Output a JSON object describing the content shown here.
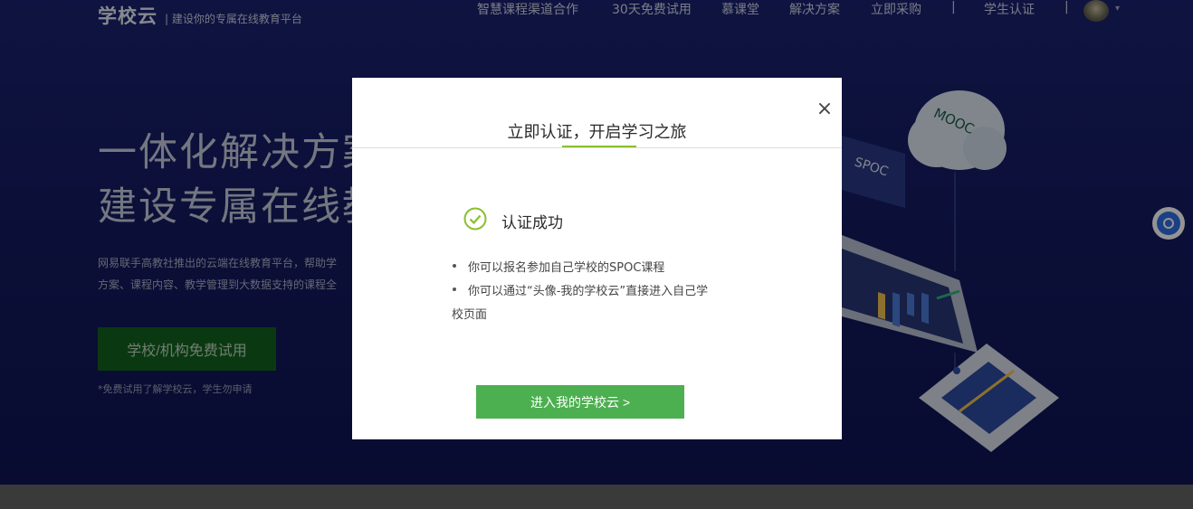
{
  "header": {
    "logo": "学校云",
    "logo_subtitle": "| 建设你的专属在线教育平台",
    "nav_items": [
      "智慧课程渠道合作",
      "30天免费试用",
      "慕课堂",
      "解决方案",
      "立即采购"
    ],
    "separator": "|",
    "student_auth": "学生认证",
    "icons": {
      "avatar": "user-avatar",
      "caret": "chevron-down-icon"
    }
  },
  "hero": {
    "line1": "一体化解决方案",
    "line2": "建设专属在线教",
    "desc1": "网易联手高教社推出的云端在线教育平台，帮助学",
    "desc2": "方案、课程内容、教学管理到大数据支持的课程全",
    "trial_button": "学校/机构免费试用",
    "trial_note": "*免费试用了解学校云，学生勿申请",
    "badges": [
      "MOOC",
      "SPOC"
    ]
  },
  "modal": {
    "title": "立即认证，开启学习之旅",
    "close": "×",
    "success_text": "认证成功",
    "tip1": "你可以报名参加自己学校的SPOC课程",
    "tip2_line1": "你可以通过“头像-我的学校云”直接进入自己学",
    "tip2_line2": "校页面",
    "enter_button": "进入我的学校云 >",
    "colors": {
      "accent_green": "#8bbf2e",
      "button_green": "#4caf50"
    }
  }
}
